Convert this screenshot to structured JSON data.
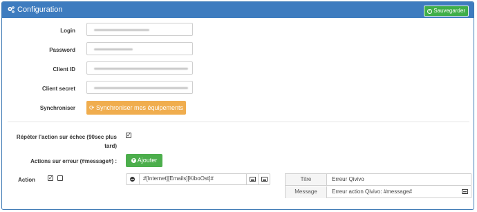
{
  "header": {
    "title": "Configuration",
    "save_label": "Sauvegarder"
  },
  "form": {
    "login_label": "Login",
    "password_label": "Password",
    "client_id_label": "Client ID",
    "client_secret_label": "Client secret",
    "sync_label": "Synchroniser",
    "sync_button": "Synchroniser mes équipements"
  },
  "options": {
    "retry_label_line1": "Répéter l'action sur échec (90sec plus",
    "retry_label_line2": "tard)",
    "retry_checked": true,
    "error_actions_label": "Actions sur erreur (#message#) :",
    "add_button": "Ajouter",
    "action_label": "Action",
    "action_checkbox1": true,
    "action_checkbox2": false,
    "command_value": "#[Internet][Emails][KiboOst]#",
    "title_key": "Titre",
    "title_value": "Erreur Qivivo",
    "message_key": "Message",
    "message_value": "Erreur action Qivivo: #message#"
  },
  "colors": {
    "header_bg": "#3e7cbf",
    "save_bg": "#3fae49",
    "sync_bg": "#f0ad4e",
    "add_bg": "#4cae4c"
  }
}
